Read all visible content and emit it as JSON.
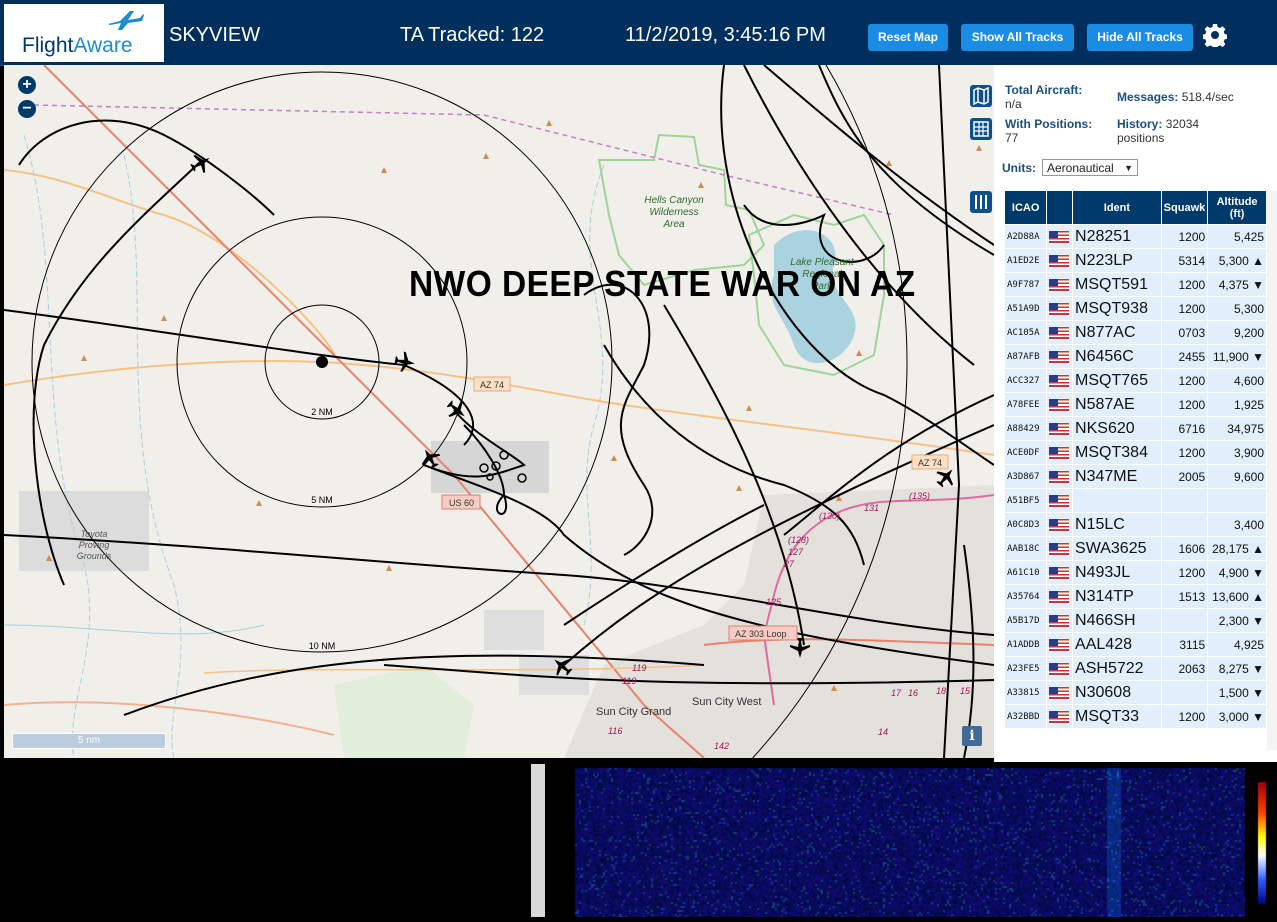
{
  "header": {
    "logo_text_1": "Flight",
    "logo_text_2": "Aware",
    "app_name": "SKYVIEW",
    "tracked": "TA Tracked: 122",
    "datetime": "11/2/2019, 3:45:16 PM",
    "buttons": [
      "Reset Map",
      "Show All Tracks",
      "Hide All Tracks"
    ]
  },
  "map": {
    "overlay_title": "NWO DEEP STATE WAR ON AZ",
    "zoom_in": "+",
    "zoom_out": "−",
    "scale": "5 nm",
    "info": "i",
    "labels": {
      "hells_canyon": "Hells Canyon",
      "wilderness": "Wilderness",
      "area": "Area",
      "lake_pleasant": "Lake Pleasant",
      "regional": "Regional",
      "park": "Park",
      "toyota": "Toyota",
      "proving": "Proving",
      "grounds": "Grounds",
      "sun_city_grand": "Sun City Grand",
      "sun_city_west": "Sun City West",
      "ring_2": "2 NM",
      "ring_5": "5 NM",
      "ring_10": "10 NM",
      "az74_a": "AZ 74",
      "az74_b": "AZ 74",
      "us60": "US 60",
      "az303": "AZ 303 Loop",
      "r130": "(130)",
      "r131": "131",
      "r135": "(135)",
      "r128": "(128)",
      "r127": "127",
      "r27": "27",
      "r125": "125",
      "r119a": "119",
      "r119b": "119",
      "r116": "116",
      "r142": "142",
      "r17": "17",
      "r16": "16",
      "r18": "18",
      "r15": "15",
      "r14": "14"
    }
  },
  "stats": {
    "total_label": "Total Aircraft:",
    "total_value": "n/a",
    "with_pos_label": "With Positions:",
    "with_pos_value": "77",
    "messages_label": "Messages:",
    "messages_value": "518.4/sec",
    "history_label": "History:",
    "history_value": "32034",
    "history_unit": "positions",
    "units_label": "Units:",
    "units_value": "Aeronautical"
  },
  "table": {
    "headers": [
      "ICAO",
      "",
      "Ident",
      "Squawk",
      "Altitude (ft)"
    ],
    "rows": [
      {
        "icao": "A2D88A",
        "ident": "N28251",
        "squawk": "1200",
        "alt": "5,425"
      },
      {
        "icao": "A1ED2E",
        "ident": "N223LP",
        "squawk": "5314",
        "alt": "5,300 ▲"
      },
      {
        "icao": "A9F787",
        "ident": "MSQT591",
        "squawk": "1200",
        "alt": "4,375 ▼"
      },
      {
        "icao": "A51A9D",
        "ident": "MSQT938",
        "squawk": "1200",
        "alt": "5,300"
      },
      {
        "icao": "AC105A",
        "ident": "N877AC",
        "squawk": "0703",
        "alt": "9,200"
      },
      {
        "icao": "A87AFB",
        "ident": "N6456C",
        "squawk": "2455",
        "alt": "11,900 ▼"
      },
      {
        "icao": "ACC327",
        "ident": "MSQT765",
        "squawk": "1200",
        "alt": "4,600"
      },
      {
        "icao": "A78FEE",
        "ident": "N587AE",
        "squawk": "1200",
        "alt": "1,925"
      },
      {
        "icao": "A88429",
        "ident": "NKS620",
        "squawk": "6716",
        "alt": "34,975"
      },
      {
        "icao": "ACE0DF",
        "ident": "MSQT384",
        "squawk": "1200",
        "alt": "3,900"
      },
      {
        "icao": "A3D867",
        "ident": "N347ME",
        "squawk": "2005",
        "alt": "9,600"
      },
      {
        "icao": "A51BF5",
        "ident": "",
        "squawk": "",
        "alt": ""
      },
      {
        "icao": "A0C8D3",
        "ident": "N15LC",
        "squawk": "",
        "alt": "3,400"
      },
      {
        "icao": "AAB18C",
        "ident": "SWA3625",
        "squawk": "1606",
        "alt": "28,175 ▲"
      },
      {
        "icao": "A61C10",
        "ident": "N493JL",
        "squawk": "1200",
        "alt": "4,900 ▼"
      },
      {
        "icao": "A35764",
        "ident": "N314TP",
        "squawk": "1513",
        "alt": "13,600 ▲"
      },
      {
        "icao": "A5B17D",
        "ident": "N466SH",
        "squawk": "",
        "alt": "2,300 ▼"
      },
      {
        "icao": "A1ADDB",
        "ident": "AAL428",
        "squawk": "3115",
        "alt": "4,925"
      },
      {
        "icao": "A23FE5",
        "ident": "ASH5722",
        "squawk": "2063",
        "alt": "8,275 ▼"
      },
      {
        "icao": "A33815",
        "ident": "N30608",
        "squawk": "",
        "alt": "1,500 ▼"
      },
      {
        "icao": "A32BBD",
        "ident": "MSQT33",
        "squawk": "1200",
        "alt": "3,000 ▼"
      }
    ]
  }
}
